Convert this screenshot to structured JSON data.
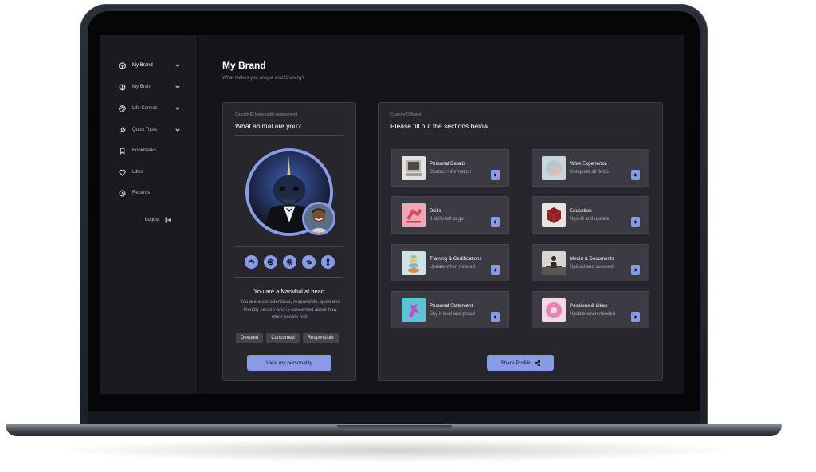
{
  "sidebar": {
    "items": [
      {
        "label": "My Brand",
        "icon": "cube-icon",
        "expandable": true,
        "active": true
      },
      {
        "label": "My Brain",
        "icon": "brain-icon",
        "expandable": true
      },
      {
        "label": "Life Canvas",
        "icon": "palette-icon",
        "expandable": true
      },
      {
        "label": "Quick Tools",
        "icon": "wrench-icon",
        "expandable": true
      },
      {
        "label": "Bookmarks",
        "icon": "bookmark-icon",
        "expandable": false
      },
      {
        "label": "Likes",
        "icon": "heart-icon",
        "expandable": false
      },
      {
        "label": "Recents",
        "icon": "clock-icon",
        "expandable": false
      }
    ],
    "logout_label": "Logout"
  },
  "header": {
    "title": "My Brand",
    "subtitle": "What makes you unique and Crunchy?"
  },
  "personality": {
    "kicker": "CrunchyID Personality Assessment",
    "title": "What animal are you?",
    "trait_icons": [
      "sunrise-icon",
      "target-icon",
      "gear-icon",
      "recycle-icon",
      "person-icon"
    ],
    "result_title": "You are a Narwhal at heart.",
    "result_description": "You are a conscientious, responsible, quiet and friendly person who is concerned about how other people feel.",
    "tags": [
      "Devoted",
      "Concerned",
      "Responsible"
    ],
    "button_label": "View my personality"
  },
  "brand": {
    "kicker": "CrunchyID Brand",
    "title": "Please fill out the sections below",
    "sections": [
      {
        "title": "Personal Details",
        "subtitle": "Contact information",
        "thumb": "computer"
      },
      {
        "title": "Work Experience",
        "subtitle": "Complete all fields",
        "thumb": "gradient-sphere"
      },
      {
        "title": "Skills",
        "subtitle": "8 skills left to go",
        "thumb": "skateboarder"
      },
      {
        "title": "Education",
        "subtitle": "Upskill and update",
        "thumb": "red-cube"
      },
      {
        "title": "Training & Certifications",
        "subtitle": "Update when needed",
        "thumb": "stacked-stones"
      },
      {
        "title": "Media & Documents",
        "subtitle": "Upload and succeed",
        "thumb": "figure"
      },
      {
        "title": "Personal Statement",
        "subtitle": "Say it loud and proud",
        "thumb": "pink-figure"
      },
      {
        "title": "Passions & Likes",
        "subtitle": "Update when needed",
        "thumb": "donut"
      }
    ],
    "share_label": "Share Profile"
  },
  "colors": {
    "accent": "#8a9be6",
    "panel": "#28262d",
    "card": "#3c3a42",
    "background": "#161419",
    "sidebar": "#1b1a20"
  }
}
